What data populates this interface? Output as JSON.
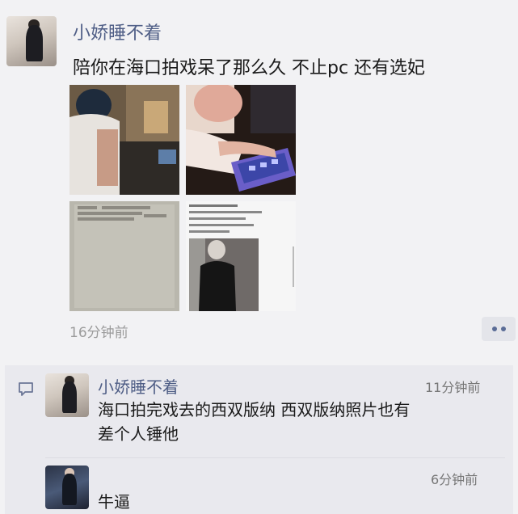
{
  "post": {
    "author": "小娇睡不着",
    "text": "陪你在海口拍戏呆了那么久 不止pc 还有选妃",
    "time": "16分钟前",
    "photos": [
      {
        "icon": "photo-man-at-desk"
      },
      {
        "icon": "photo-hands-tablet"
      },
      {
        "icon": "photo-chat-screenshot"
      },
      {
        "icon": "photo-chat-and-person"
      }
    ]
  },
  "comments": [
    {
      "author": "小娇睡不着",
      "time": "11分钟前",
      "line1": "海口拍完戏去的西双版纳 西双版纳照片也有",
      "line2": "差个人锤他"
    },
    {
      "author": "",
      "time": "6分钟前",
      "line1": "牛逼"
    }
  ],
  "colors": {
    "name": "#4f5e86",
    "background": "#f2f2f4",
    "comment_bg": "#e9e9ee"
  }
}
